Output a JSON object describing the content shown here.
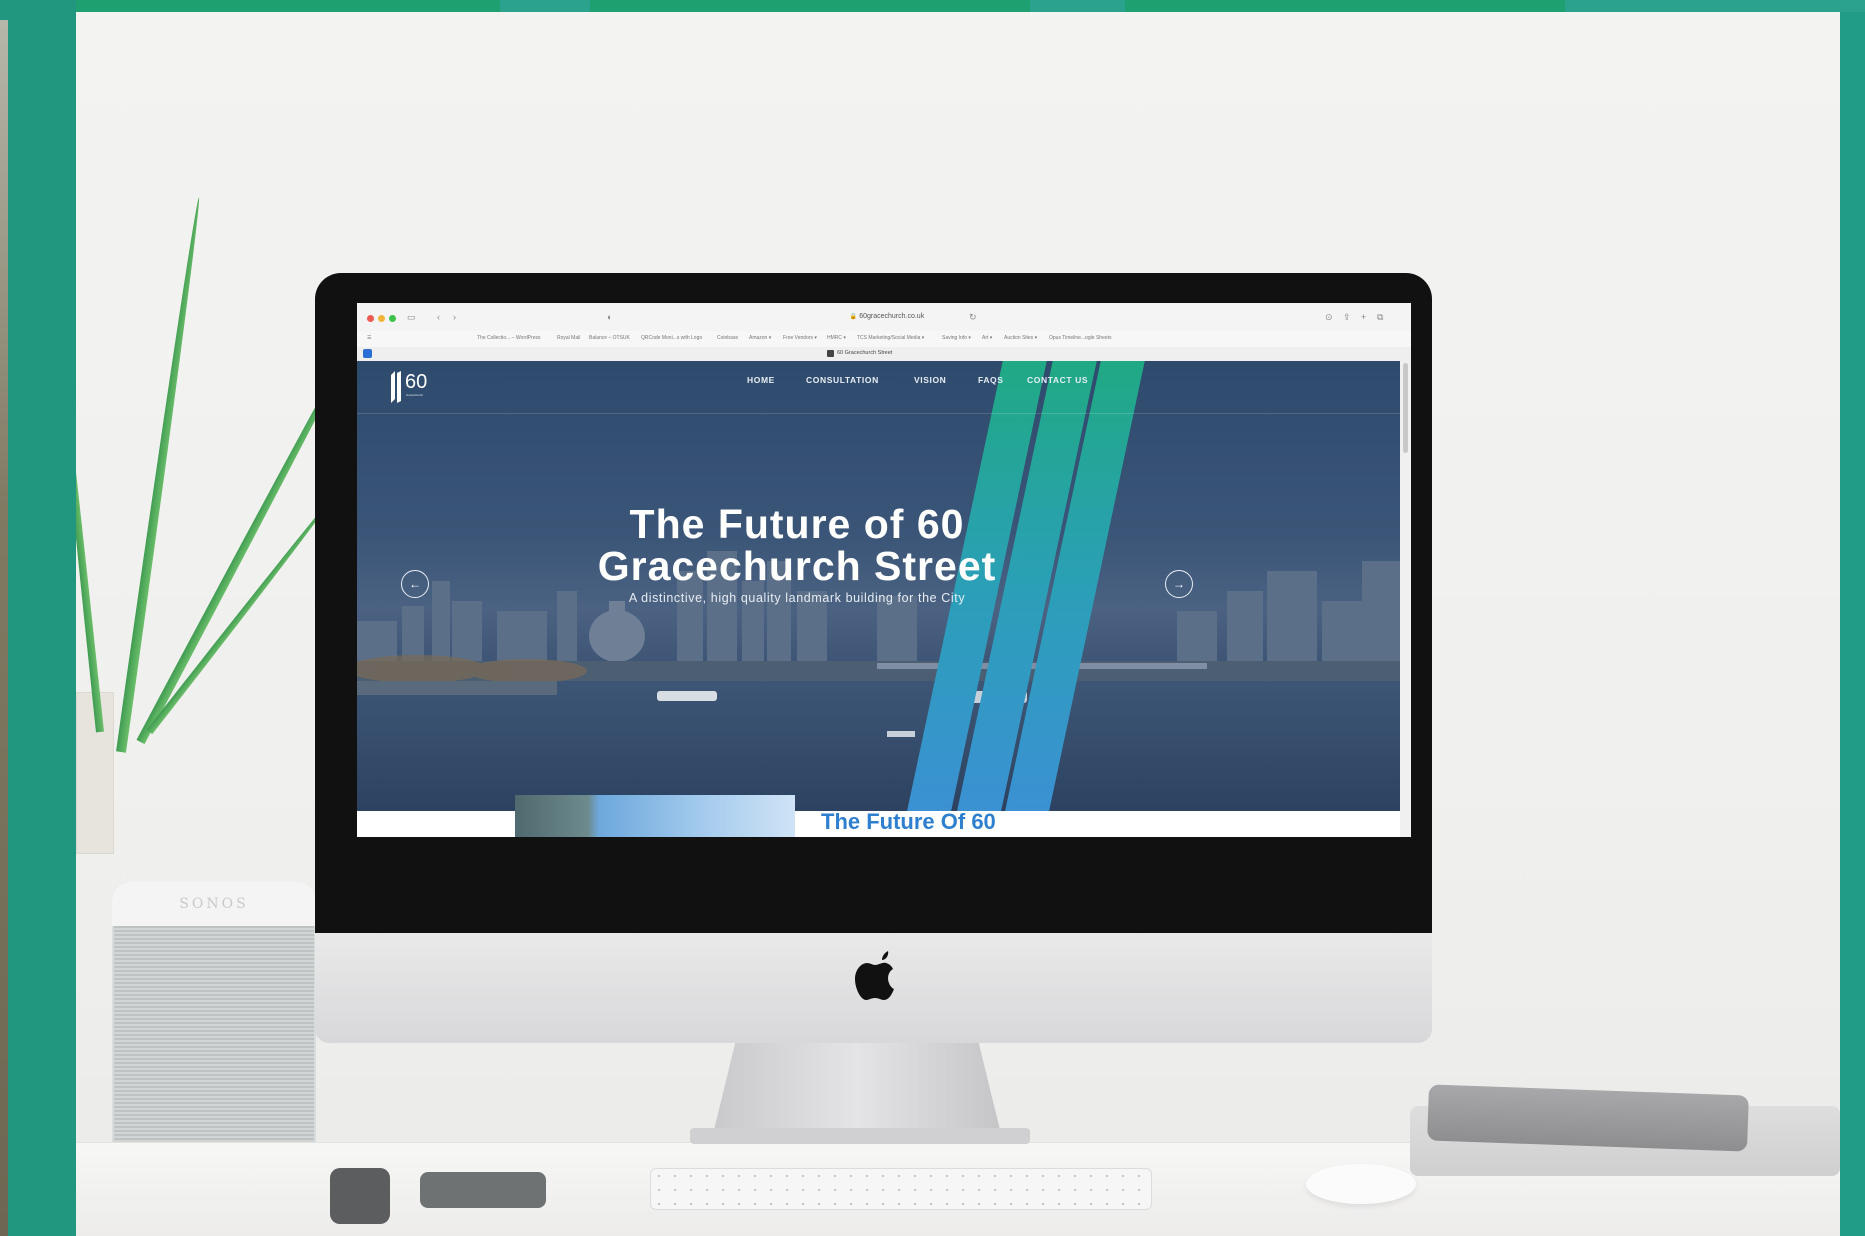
{
  "browser": {
    "url": "60gracechurch.co.uk",
    "tab_title": "60 Gracechurch Street",
    "bookmarks": [
      "The Collectio... – WordPress",
      "Royal Mail",
      "Balance – OTSUK",
      "QRCode Moni...s with Logo",
      "Coinbase",
      "Amazon ▾",
      "Free Vendors ▾",
      "HMRC ▾",
      "TCS Marketing/Social Media ▾",
      "Saving Info ▾",
      "Art ▾",
      "Auction Sites ▾",
      "Opus Timeline...ogle Sheets"
    ]
  },
  "site": {
    "logo_number": "60",
    "logo_subtext": "Gracechurch",
    "nav": [
      "HOME",
      "CONSULTATION",
      "VISION",
      "FAQS",
      "CONTACT US"
    ],
    "hero_title_line1": "The Future of 60",
    "hero_title_line2": "Gracechurch Street",
    "hero_subtitle": "A distinctive, high quality landmark building for the City",
    "prev_arrow": "←",
    "next_arrow": "→",
    "section_heading": "The Future Of 60"
  },
  "scene": {
    "speaker_brand": "SONOS"
  },
  "colors": {
    "frame": "#219c86",
    "stripe_green": "#1fa57a",
    "stripe_blue": "#3d8fd6",
    "hero_overlay": "#2e4a6c",
    "heading_blue": "#2f7fcf"
  },
  "icons": [
    "apple-logo-icon",
    "arrow-left-icon",
    "arrow-right-icon",
    "sidebar-icon",
    "share-icon",
    "new-tab-icon",
    "tabs-overview-icon",
    "lock-icon"
  ]
}
